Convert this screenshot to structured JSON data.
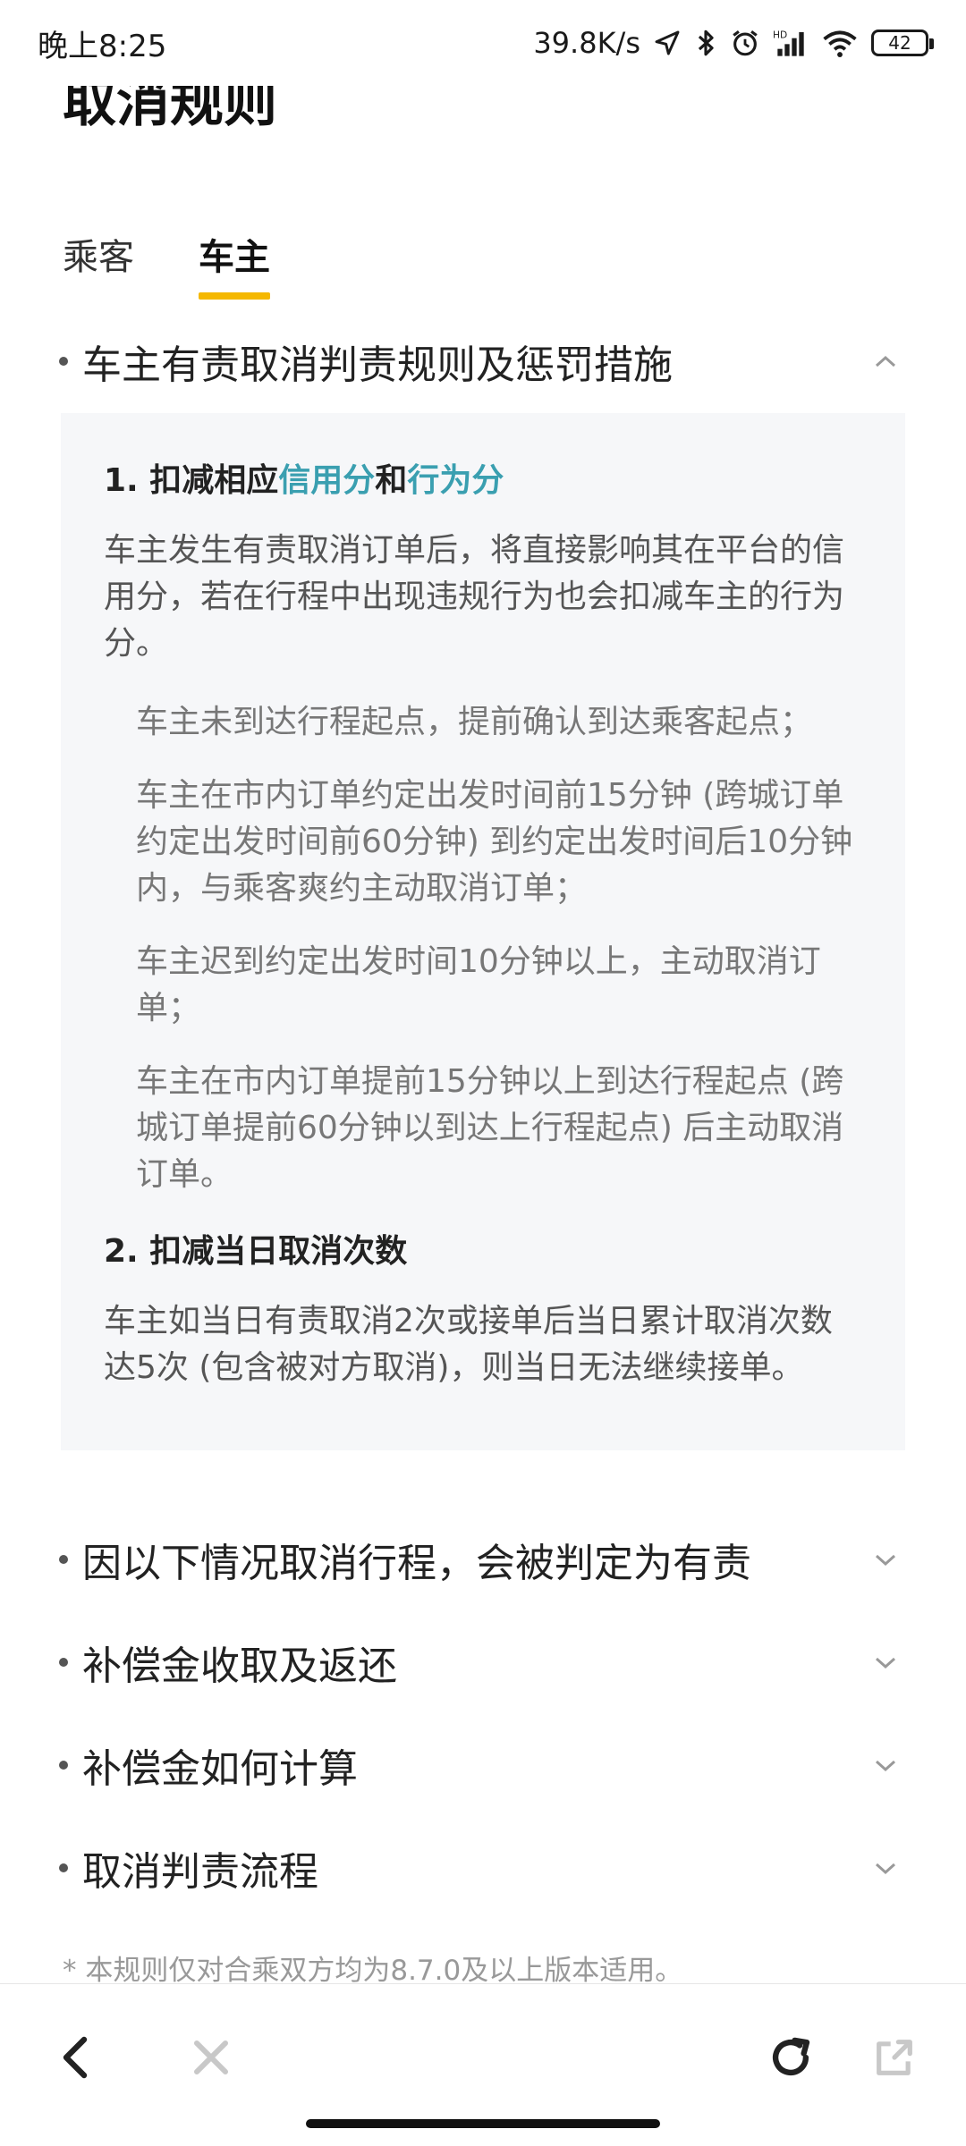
{
  "status_bar": {
    "time": "晚上8:25",
    "network_speed": "39.8K/s",
    "battery": "42"
  },
  "page": {
    "title": "取消规则"
  },
  "tabs": [
    {
      "label": "乘客",
      "active": false
    },
    {
      "label": "车主",
      "active": true
    }
  ],
  "accordion": {
    "expanded": {
      "title": "车主有责取消判责规则及惩罚措施",
      "section1": {
        "num": "1. ",
        "prefix": "扣减相应",
        "credit": "信用分",
        "and": "和",
        "behavior": "行为分"
      },
      "section1_body": "车主发生有责取消订单后，将直接影响其在平台的信用分，若在行程中出现违规行为也会扣减车主的行为分。",
      "items": [
        "车主未到达行程起点，提前确认到达乘客起点；",
        "车主在市内订单约定出发时间前15分钟 (跨城订单约定出发时间前60分钟) 到约定出发时间后10分钟内，与乘客爽约主动取消订单；",
        "车主迟到约定出发时间10分钟以上，主动取消订单；",
        "车主在市内订单提前15分钟以上到达行程起点 (跨城订单提前60分钟以到达上行程起点) 后主动取消订单。"
      ],
      "section2": "2. 扣减当日取消次数",
      "section2_body": "车主如当日有责取消2次或接单后当日累计取消次数达5次 (包含被对方取消)，则当日无法继续接单。"
    },
    "collapsed": [
      "因以下情况取消行程，会被判定为有责",
      "补偿金收取及返还",
      "补偿金如何计算",
      "取消判责流程"
    ]
  },
  "footnote": "* 本规则仅对合乘双方均为8.7.0及以上版本适用。",
  "colors": {
    "accent": "#f5b800",
    "link": "#3a9fb0",
    "panel_bg": "#f6f7f9"
  }
}
